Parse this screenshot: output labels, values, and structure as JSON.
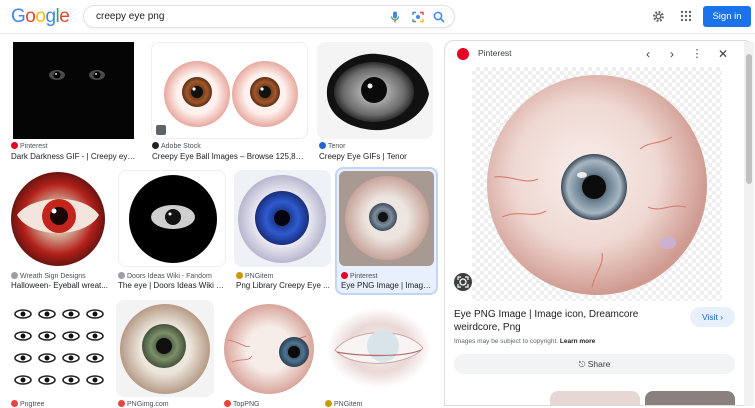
{
  "header": {
    "logo_letters": [
      {
        "ch": "G",
        "color": "#4285f4"
      },
      {
        "ch": "o",
        "color": "#ea4335"
      },
      {
        "ch": "o",
        "color": "#fbbc05"
      },
      {
        "ch": "g",
        "color": "#4285f4"
      },
      {
        "ch": "l",
        "color": "#34a853"
      },
      {
        "ch": "e",
        "color": "#ea4335"
      }
    ],
    "query": "creepy eye png",
    "signin_label": "Sign in"
  },
  "results": [
    {
      "source": "Pinterest",
      "title": "Dark Darkness GIF - | Creepy eyes ...",
      "fav_color": "#e60023"
    },
    {
      "source": "Adobe Stock",
      "title": "Creepy Eye Ball Images – Browse 125,803 ...",
      "fav_color": "#222222"
    },
    {
      "source": "Tenor",
      "title": "Creepy Eye GIFs | Tenor",
      "fav_color": "#1f66d1"
    },
    {
      "source": "Wreath Sign Designs",
      "title": "Halloween- Eyeball wreat...",
      "fav_color": "#9aa0a6"
    },
    {
      "source": "Doors Ideas Wiki - Fandom",
      "title": "The eye | Doors Ideas Wiki | ...",
      "fav_color": "#9aa0a6"
    },
    {
      "source": "PNGitem",
      "title": "Png Library Creepy Eye ...",
      "fav_color": "#c99a00"
    },
    {
      "source": "Pinterest",
      "title": "Eye PNG Image | Image i...",
      "fav_color": "#e60023"
    },
    {
      "source": "Pngtree",
      "title": "",
      "fav_color": "#e8453c"
    },
    {
      "source": "PNGimg.com",
      "title": "",
      "fav_color": "#e8453c"
    },
    {
      "source": "TopPNG",
      "title": "",
      "fav_color": "#e8453c"
    },
    {
      "source": "PNGitem",
      "title": "",
      "fav_color": "#c99a00"
    }
  ],
  "panel": {
    "source": "Pinterest",
    "title": "Eye PNG Image | Image icon, Dreamcore weirdcore, Png",
    "copyright_text": "Images may be subject to copyright.",
    "learn_more": "Learn more",
    "visit_label": "Visit",
    "share_label": "Share"
  }
}
